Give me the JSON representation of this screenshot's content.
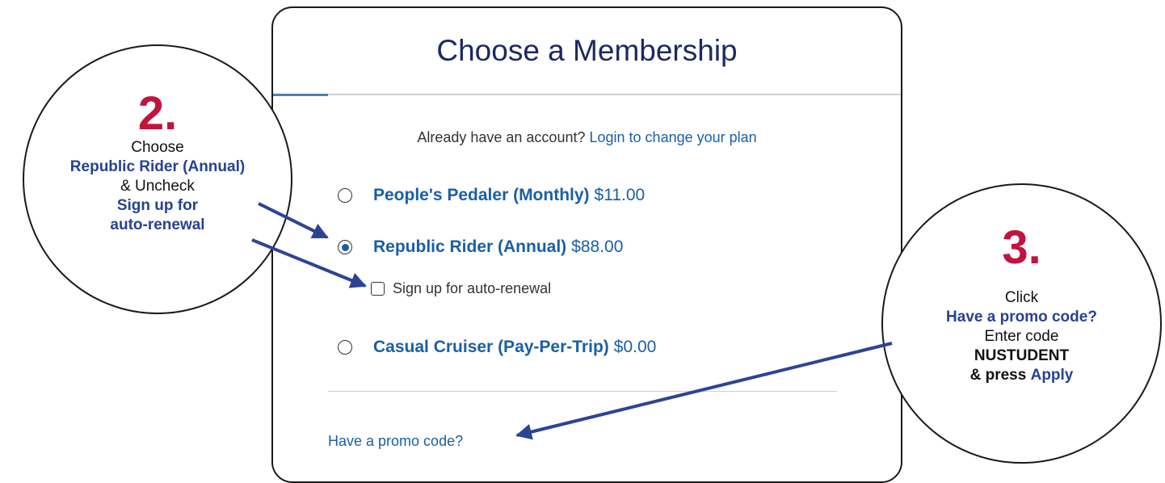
{
  "membership": {
    "title": "Choose a Membership",
    "account_prompt": "Already have an account?",
    "login_link": "Login to change your plan",
    "plans": [
      {
        "name": "People's Pedaler (Monthly)",
        "price": "$11.00",
        "selected": false
      },
      {
        "name": "Republic Rider (Annual)",
        "price": "$88.00",
        "selected": true
      },
      {
        "name": "Casual Cruiser (Pay-Per-Trip)",
        "price": "$0.00",
        "selected": false
      }
    ],
    "auto_renew_label": "Sign up for auto-renewal",
    "auto_renew_checked": false,
    "promo_link": "Have a promo code?"
  },
  "annotations": {
    "step2": {
      "number": "2.",
      "line1": "Choose",
      "line2": "Republic Rider (Annual)",
      "line3": "& Uncheck",
      "line4": "Sign up for",
      "line5": "auto-renewal"
    },
    "step3": {
      "number": "3.",
      "line1": "Click",
      "line2": "Have a promo code?",
      "line3": "Enter code",
      "line4": "NUSTUDENT",
      "line5_prefix": "& press",
      "line5_action": "Apply"
    }
  },
  "colors": {
    "step_number": "#c0143c",
    "annotation_highlight": "#274293",
    "link": "#1a5fa6",
    "title": "#1d2960",
    "arrow": "#2d4494"
  }
}
